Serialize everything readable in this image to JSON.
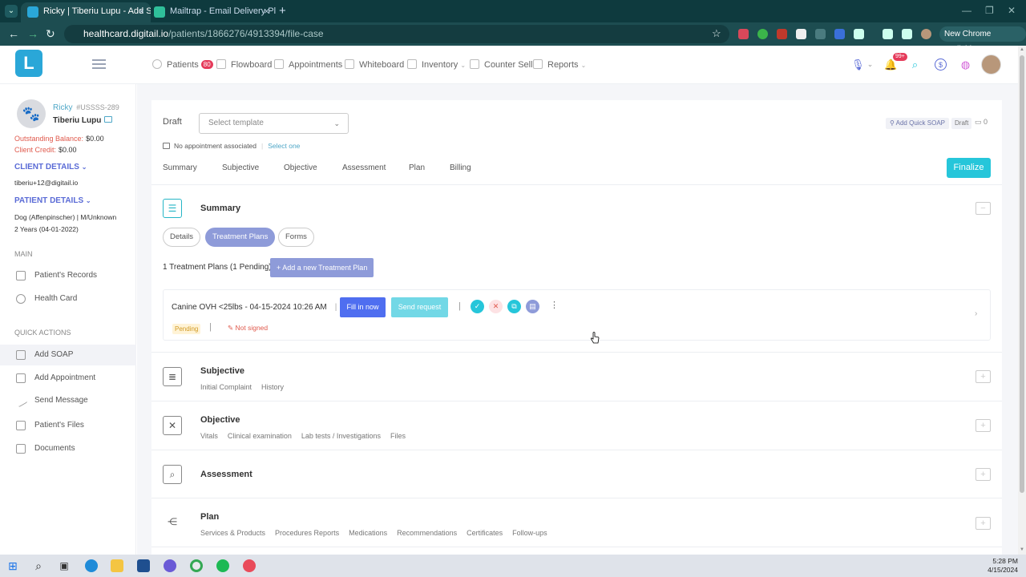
{
  "browser": {
    "tabs": [
      {
        "title": "Ricky | Tiberiu Lupu - Add SOAP",
        "active": true
      },
      {
        "title": "Mailtrap - Email Delivery Platfo",
        "active": false
      }
    ],
    "url_domain": "healthcard.digitail.io",
    "url_path": "/patients/1866276/4913394/file-case",
    "chrome_update": "New Chrome available"
  },
  "header": {
    "nav": [
      {
        "label": "Patients",
        "badge": "80"
      },
      {
        "label": "Flowboard"
      },
      {
        "label": "Appointments"
      },
      {
        "label": "Whiteboard"
      },
      {
        "label": "Inventory"
      },
      {
        "label": "Counter Sell"
      },
      {
        "label": "Reports"
      }
    ],
    "notif_badge": "99+"
  },
  "sidebar": {
    "pet_name": "Ricky",
    "pet_id": "#USSSS-289",
    "owner_name": "Tiberiu Lupu",
    "outstanding_label": "Outstanding Balance:",
    "outstanding_value": "$0.00",
    "credit_label": "Client Credit:",
    "credit_value": "$0.00",
    "client_details_title": "CLIENT DETAILS",
    "client_email": "tiberiu+12@digitail.io",
    "patient_details_title": "PATIENT DETAILS",
    "patient_species": "Dog (Affenpinscher)  |  M/Unknown",
    "patient_age": "2 Years (04-01-2022)",
    "main_heading": "MAIN",
    "main_items": [
      {
        "label": "Patient's Records"
      },
      {
        "label": "Health Card"
      }
    ],
    "quick_heading": "QUICK ACTIONS",
    "quick_items": [
      {
        "label": "Add SOAP"
      },
      {
        "label": "Add Appointment"
      },
      {
        "label": "Send Message"
      },
      {
        "label": "Patient's Files"
      },
      {
        "label": "Documents"
      }
    ]
  },
  "soap": {
    "draft_label": "Draft",
    "template_placeholder": "Select template",
    "quick_soap": "Add Quick SOAP",
    "draft_tag": "Draft",
    "comment_count": "0",
    "no_appointment": "No appointment associated",
    "select_one": "Select one",
    "tabs": [
      "Summary",
      "Subjective",
      "Objective",
      "Assessment",
      "Plan",
      "Billing"
    ],
    "finalize": "Finalize"
  },
  "summary": {
    "title": "Summary",
    "pills": [
      "Details",
      "Treatment Plans",
      "Forms"
    ],
    "tp_count": "1 Treatment Plans (1 Pending)",
    "add_tp": "+ Add a new Treatment Plan",
    "plan": {
      "name": "Canine OVH <25lbs",
      "datetime": "- 04-15-2024 10:26 AM",
      "fill_in": "Fill in now",
      "send_request": "Send request",
      "status": "Pending",
      "signature": "Not signed"
    }
  },
  "sections": {
    "subjective": {
      "title": "Subjective",
      "links": [
        "Initial Complaint",
        "History"
      ]
    },
    "objective": {
      "title": "Objective",
      "links": [
        "Vitals",
        "Clinical examination",
        "Lab tests / Investigations",
        "Files"
      ]
    },
    "assessment": {
      "title": "Assessment"
    },
    "plan": {
      "title": "Plan",
      "links": [
        "Services & Products",
        "Procedures Reports",
        "Medications",
        "Recommendations",
        "Certificates",
        "Follow-ups"
      ]
    }
  },
  "taskbar": {
    "time": "5:28 PM",
    "date": "4/15/2024"
  },
  "colors": {
    "accent": "#26c6da",
    "primary": "#4f6ef0",
    "lavender": "#8e9bd9",
    "chrome_dark": "#0e3a3e"
  }
}
